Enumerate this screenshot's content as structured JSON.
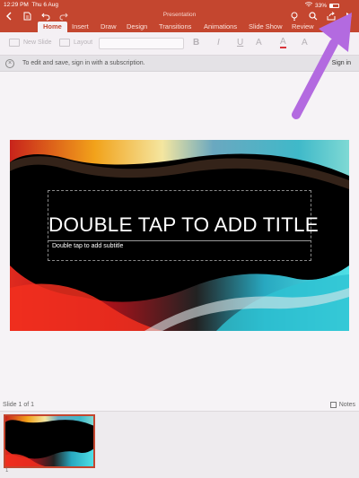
{
  "status_bar": {
    "time": "12:29 PM",
    "date": "Thu 6 Aug",
    "battery": "33%"
  },
  "title_bar": {
    "doc_title": "Presentation",
    "icons": [
      "back-icon",
      "file-icon",
      "undo-icon",
      "redo-icon",
      "lightbulb-icon",
      "search-icon",
      "share-icon",
      "play-icon"
    ]
  },
  "tabs": [
    {
      "label": "Home",
      "active": true
    },
    {
      "label": "Insert"
    },
    {
      "label": "Draw"
    },
    {
      "label": "Design"
    },
    {
      "label": "Transitions"
    },
    {
      "label": "Animations"
    },
    {
      "label": "Slide Show"
    },
    {
      "label": "Review"
    }
  ],
  "toolbar": {
    "new_slide": "New Slide",
    "layout": "Layout",
    "bold": "B",
    "italic": "I",
    "underline": "U",
    "clear_format": "A",
    "font_color": "A",
    "highlight": "A"
  },
  "notice": {
    "message": "To edit and save, sign in with a subscription.",
    "sign_in": "Sign in"
  },
  "slide": {
    "title": "DOUBLE TAP TO ADD TITLE",
    "subtitle": "Double tap to add subtitle"
  },
  "footer": {
    "slide_count": "Slide 1 of 1",
    "notes": "Notes",
    "thumb_number": "1"
  },
  "colors": {
    "accent": "#c4462f",
    "annotation_arrow": "#b36ae0"
  }
}
